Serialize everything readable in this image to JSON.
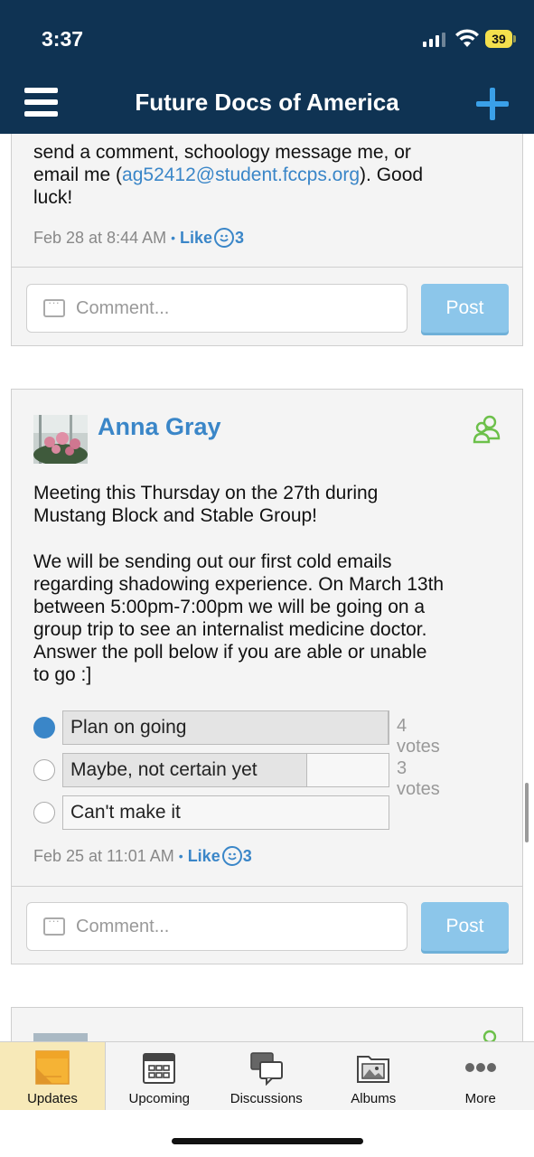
{
  "status_bar": {
    "time": "3:37",
    "battery": "39"
  },
  "header": {
    "title": "Future Docs of America"
  },
  "previous_post": {
    "text_line1": "send a comment, schoology message me, or",
    "text_line2_prefix": "email me (",
    "email": "ag52412@student.fccps.org",
    "text_line2_suffix": "). Good",
    "text_line3": "luck!",
    "timestamp": "Feb 28 at 8:44 AM",
    "like_label": "Like",
    "like_count": "3",
    "comment_placeholder": "Comment...",
    "post_label": "Post"
  },
  "main_post": {
    "author": "Anna Gray",
    "paragraph1_line1": "Meeting this Thursday on the 27th during",
    "paragraph1_line2": "Mustang Block and Stable Group!",
    "paragraph2": [
      "We will be sending out our first cold emails",
      "regarding shadowing experience. On March 13th",
      "between 5:00pm-7:00pm we will be going on a",
      "group trip to see an internalist medicine doctor.",
      "Answer the poll below if you are able or unable",
      "to go :]"
    ],
    "poll": [
      {
        "label": "Plan on going",
        "votes": "4 votes",
        "fraction": 1.0,
        "selected": true
      },
      {
        "label": "Maybe, not certain yet",
        "votes": "3 votes",
        "fraction": 0.75,
        "selected": false
      },
      {
        "label": "Can't make it",
        "votes": "",
        "fraction": 0,
        "selected": false
      }
    ],
    "timestamp": "Feb 25 at 11:01 AM",
    "like_label": "Like",
    "like_count": "3",
    "comment_placeholder": "Comment...",
    "post_label": "Post"
  },
  "tabs": [
    {
      "label": "Updates",
      "icon": "updates-icon",
      "active": true
    },
    {
      "label": "Upcoming",
      "icon": "calendar-icon",
      "active": false
    },
    {
      "label": "Discussions",
      "icon": "discussions-icon",
      "active": false
    },
    {
      "label": "Albums",
      "icon": "albums-icon",
      "active": false
    },
    {
      "label": "More",
      "icon": "more-icon",
      "active": false
    }
  ],
  "colors": {
    "header_bg": "#0f3353",
    "accent": "#3a86c8",
    "plus": "#3aa0e8",
    "group_icon": "#6cc04a"
  }
}
